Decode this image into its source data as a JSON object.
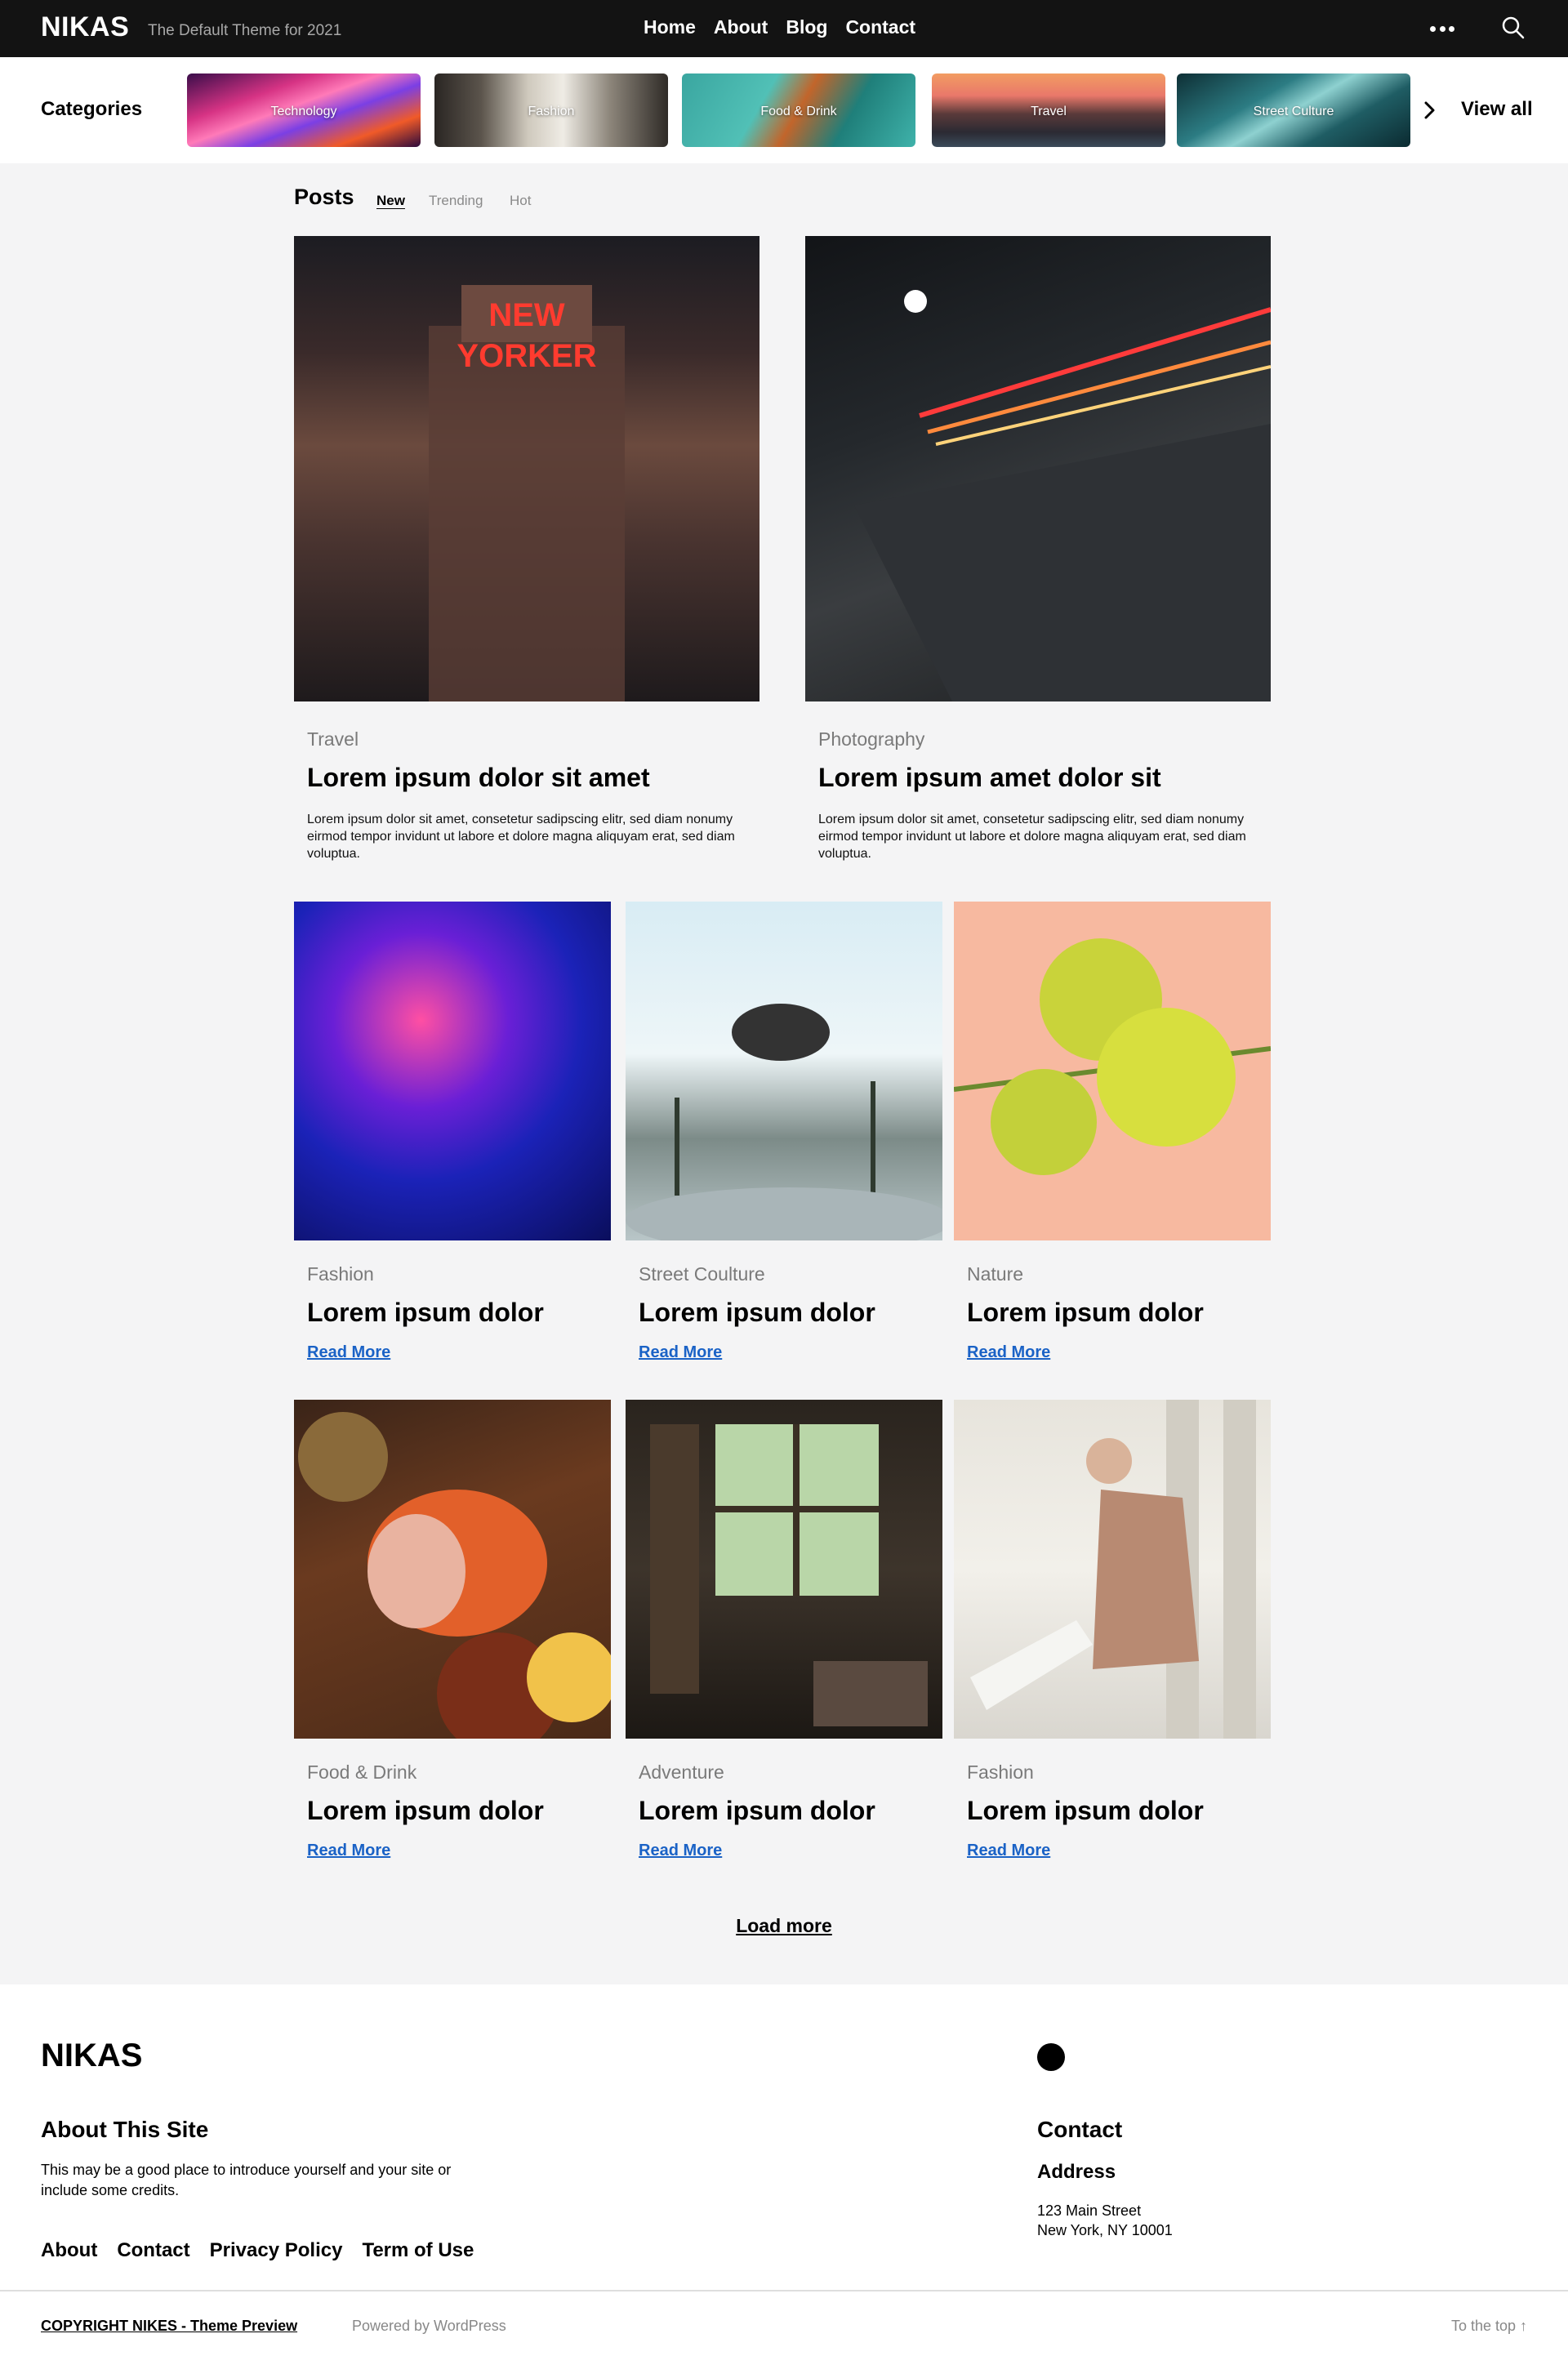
{
  "header": {
    "brand": "NIKAS",
    "tagline": "The Default Theme for 2021",
    "nav": [
      "Home",
      "About",
      "Blog",
      "Contact"
    ],
    "more_icon": "ellipsis-icon",
    "search_icon": "search-icon"
  },
  "categories": {
    "title": "Categories",
    "items": [
      "Technology",
      "Fashion",
      "Food & Drink",
      "Travel",
      "Street Culture"
    ],
    "view_all": "View all",
    "arrow_icon": "chevron-right-icon"
  },
  "posts": {
    "title": "Posts",
    "tabs": [
      "New",
      "Trending",
      "Hot"
    ],
    "active_tab": "New",
    "featured": [
      {
        "category": "Travel",
        "title": "Lorem ipsum dolor sit amet",
        "excerpt": "Lorem ipsum dolor sit amet, consetetur sadipscing elitr, sed diam nonumy eirmod tempor invidunt ut labore et dolore magna aliquyam erat, sed diam voluptua."
      },
      {
        "category": "Photography",
        "title": "Lorem ipsum amet dolor sit",
        "excerpt": "Lorem ipsum dolor sit amet, consetetur sadipscing elitr, sed diam nonumy eirmod tempor invidunt ut labore et dolore magna aliquyam erat, sed diam voluptua."
      }
    ],
    "grid": [
      {
        "category": "Fashion",
        "title": "Lorem ipsum dolor",
        "read_more": "Read More"
      },
      {
        "category": "Street Coulture",
        "title": "Lorem ipsum dolor",
        "read_more": "Read More"
      },
      {
        "category": "Nature",
        "title": "Lorem ipsum dolor",
        "read_more": "Read More"
      },
      {
        "category": "Food & Drink",
        "title": "Lorem ipsum dolor",
        "read_more": "Read More"
      },
      {
        "category": "Adventure",
        "title": "Lorem ipsum dolor",
        "read_more": "Read More"
      },
      {
        "category": "Fashion",
        "title": "Lorem ipsum dolor",
        "read_more": "Read More"
      }
    ],
    "load_more": "Load more"
  },
  "footer": {
    "brand": "NIKAS",
    "about_heading": "About This Site",
    "about_text": "This may be a good place to introduce yourself and your site or include some credits.",
    "links": [
      "About",
      "Contact",
      "Privacy Policy",
      "Term of Use"
    ],
    "contact_heading": "Contact",
    "address_heading": "Address",
    "address_line1": "123 Main Street",
    "address_line2": "New York, NY 10001",
    "copyright": "COPYRIGHT NIKES - Theme Preview",
    "powered": "Powered by WordPress",
    "to_top": "To the top ↑"
  },
  "colors": {
    "header_bg": "#131313",
    "page_bg": "#f4f4f5",
    "link_blue": "#1a62c6",
    "muted": "#7a7a7a"
  }
}
